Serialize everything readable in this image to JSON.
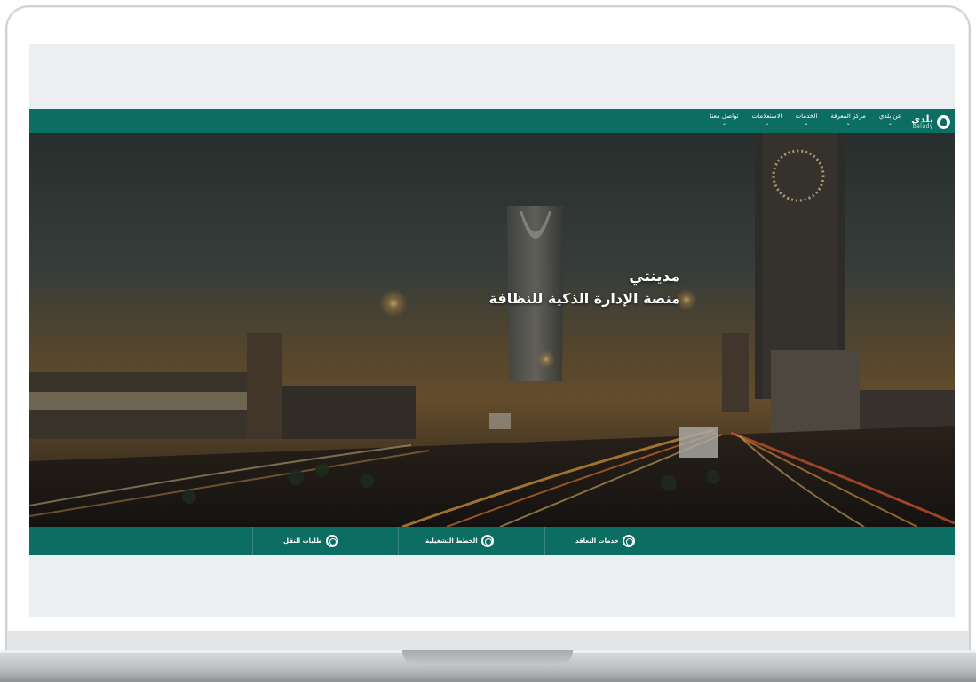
{
  "header": {
    "logo_ar": "بلدي",
    "logo_en": "balady",
    "nav": [
      {
        "label": "عن بلدي"
      },
      {
        "label": "مركز المعرفة"
      },
      {
        "label": "الخدمات"
      },
      {
        "label": "الاستعلامات"
      },
      {
        "label": "تواصل معنا"
      }
    ]
  },
  "hero": {
    "title": "مدينتي",
    "subtitle": "منصة الإدارة الذكية للنظافة"
  },
  "services": [
    {
      "label": "خدمات التعاقد"
    },
    {
      "label": "الخطط التشغيلية"
    },
    {
      "label": "طلبات النقل"
    }
  ],
  "colors": {
    "brand": "#0c6d63",
    "screen_bg": "#eceff1",
    "text": "#ffffff"
  },
  "icons": {
    "logo": "palm-logo-icon",
    "nav_chevron": "chevron-down-icon",
    "service": "circle-emblem-icon"
  }
}
